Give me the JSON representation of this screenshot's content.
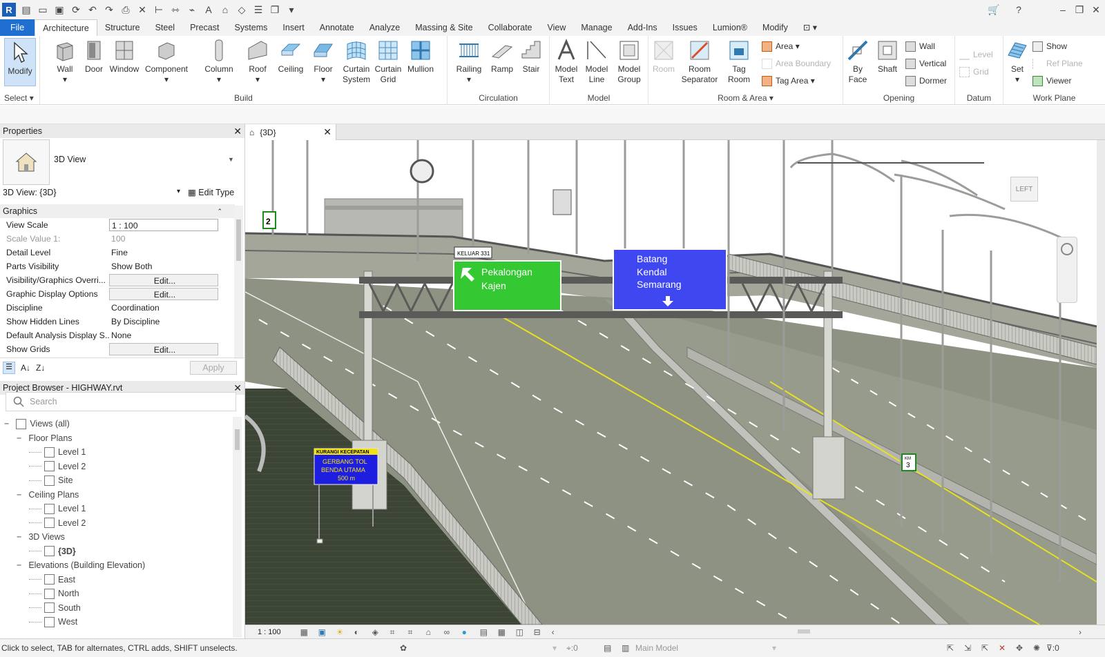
{
  "app": {
    "logo_letter": "R",
    "accent": "#1f6fd1"
  },
  "menu": {
    "tabs": [
      "File",
      "Architecture",
      "Structure",
      "Steel",
      "Precast",
      "Systems",
      "Insert",
      "Annotate",
      "Analyze",
      "Massing & Site",
      "Collaborate",
      "View",
      "Manage",
      "Add-Ins",
      "Issues",
      "Lumion®",
      "Modify"
    ],
    "active": "Architecture"
  },
  "ribbon": {
    "select": {
      "modify": "Modify",
      "select_label": "Select"
    },
    "build": {
      "label": "Build",
      "wall": "Wall",
      "door": "Door",
      "window": "Window",
      "component": "Component",
      "column": "Column",
      "roof": "Roof",
      "ceiling": "Ceiling",
      "floor": "Floor",
      "curtain_system": "Curtain System",
      "curtain_grid": "Curtain Grid",
      "mullion": "Mullion"
    },
    "circulation": {
      "label": "Circulation",
      "railing": "Railing",
      "ramp": "Ramp",
      "stair": "Stair"
    },
    "model": {
      "label": "Model",
      "model_text": "Model Text",
      "model_line": "Model Line",
      "model_group": "Model Group"
    },
    "room_area": {
      "label": "Room & Area",
      "room": "Room",
      "room_separator": "Room Separator",
      "tag_room": "Tag Room",
      "area": "Area",
      "area_boundary": "Area Boundary",
      "tag_area": "Tag Area"
    },
    "opening": {
      "label": "Opening",
      "by_face": "By Face",
      "shaft": "Shaft",
      "wall": "Wall",
      "vertical": "Vertical",
      "dormer": "Dormer"
    },
    "datum": {
      "label": "Datum",
      "level": "Level",
      "grid": "Grid"
    },
    "work_plane": {
      "label": "Work Plane",
      "set": "Set",
      "show": "Show",
      "ref_plane": "Ref Plane",
      "viewer": "Viewer"
    }
  },
  "properties": {
    "title": "Properties",
    "type_name": "3D View",
    "instance": "3D View: {3D}",
    "edit_type": "Edit Type",
    "section": "Graphics",
    "rows": [
      {
        "key": "View Scale",
        "value": "1 : 100"
      },
      {
        "key": "Scale Value    1:",
        "value": "100"
      },
      {
        "key": "Detail Level",
        "value": "Fine"
      },
      {
        "key": "Parts Visibility",
        "value": "Show Both"
      },
      {
        "key": "Visibility/Graphics Overri...",
        "value": "Edit..."
      },
      {
        "key": "Graphic Display Options",
        "value": "Edit..."
      },
      {
        "key": "Discipline",
        "value": "Coordination"
      },
      {
        "key": "Show Hidden Lines",
        "value": "By Discipline"
      },
      {
        "key": "Default Analysis Display S...",
        "value": "None"
      },
      {
        "key": "Show Grids",
        "value": "Edit..."
      }
    ],
    "apply": "Apply"
  },
  "browser": {
    "title": "Project Browser - HIGHWAY.rvt",
    "search_placeholder": "Search",
    "items": [
      {
        "label": "Views (all)",
        "level": 0
      },
      {
        "label": "Floor Plans",
        "level": 1
      },
      {
        "label": "Level 1",
        "level": 2
      },
      {
        "label": "Level 2",
        "level": 2
      },
      {
        "label": "Site",
        "level": 2
      },
      {
        "label": "Ceiling Plans",
        "level": 1
      },
      {
        "label": "Level 1",
        "level": 2
      },
      {
        "label": "Level 2",
        "level": 2
      },
      {
        "label": "3D Views",
        "level": 1
      },
      {
        "label": "{3D}",
        "level": 2
      },
      {
        "label": "Elevations (Building Elevation)",
        "level": 1
      },
      {
        "label": "East",
        "level": 2
      },
      {
        "label": "North",
        "level": 2
      },
      {
        "label": "South",
        "level": 2
      },
      {
        "label": "West",
        "level": 2
      }
    ]
  },
  "view": {
    "tab_label": "{3D}",
    "scale": "1 : 100",
    "viewcube_face": "LEFT",
    "signs": {
      "green_line1": "Pekalongan",
      "green_line2": "Kajen",
      "blue_line1": "Batang",
      "blue_line2": "Kendal",
      "blue_line3": "Semarang",
      "exit_label": "KELUAR",
      "exit_number": "331",
      "speed_header": "KURANGI KECEPATAN",
      "speed_line1": "GERBANG TOL",
      "speed_line2": "BENDA UTAMA",
      "speed_line3": "500 m",
      "km_label": "KM",
      "km_value": "3",
      "left_marker": "2"
    },
    "colors": {
      "green_sign": "#34c832",
      "blue_sign": "#3f47f0",
      "road": "#8e9282",
      "grass": "#3a4432",
      "sky": "#ffffff"
    }
  },
  "status": {
    "hint": "Click to select, TAB for alternates, CTRL adds, SHIFT unselects.",
    "workset_count": ":0",
    "model": "Main Model",
    "filter_count": ":0"
  }
}
